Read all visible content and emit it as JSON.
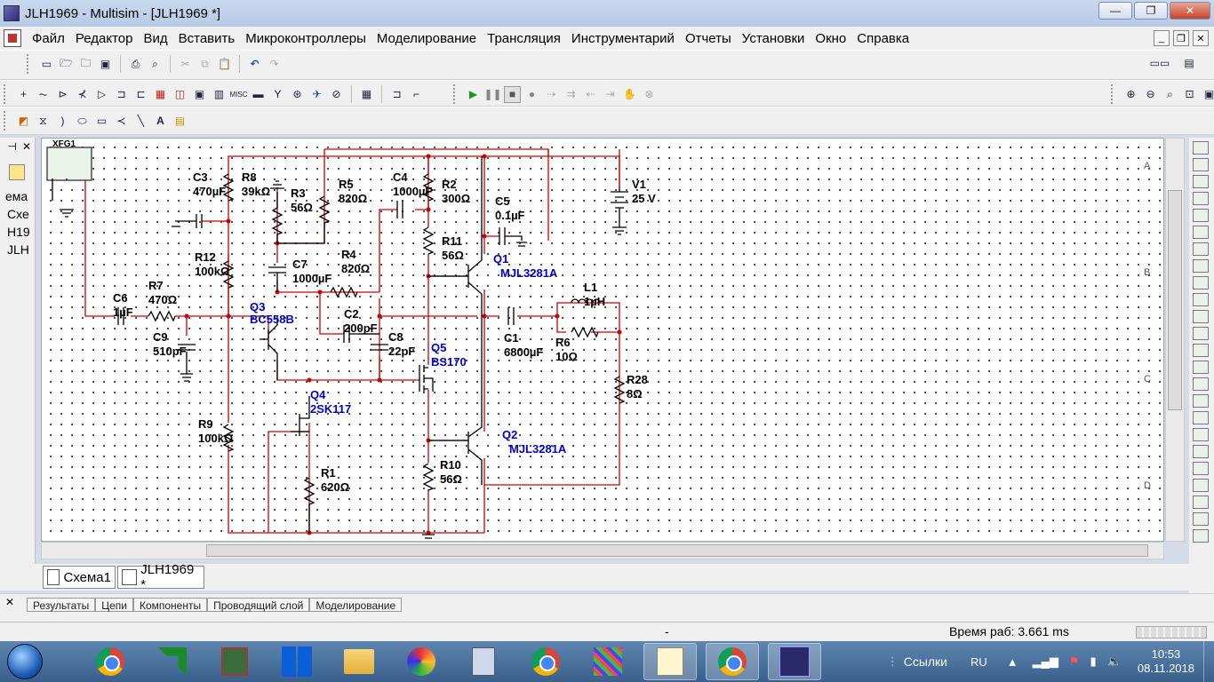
{
  "window": {
    "title": "JLH1969 - Multisim - [JLH1969 *]",
    "buttons": [
      "—",
      "❐",
      "✕"
    ]
  },
  "menu": [
    "Файл",
    "Редактор",
    "Вид",
    "Вставить",
    "Микроконтроллеры",
    "Моделирование",
    "Трансляция",
    "Инструментарий",
    "Отчеты",
    "Установки",
    "Окно",
    "Справка"
  ],
  "toolbar1": {
    "icons": [
      "new-icon",
      "open-icon",
      "open-folder-icon",
      "save-icon",
      "print-icon",
      "print-preview-icon",
      "cut-icon",
      "copy-icon",
      "paste-icon",
      "undo-icon",
      "redo-icon"
    ]
  },
  "toolbar2": {
    "component_icons": [
      "source-icon",
      "basic-icon",
      "diode-icon",
      "transistor-icon",
      "analog-icon",
      "ttl-icon",
      "cmos-icon",
      "mcu-icon",
      "advanced-peripherals-icon",
      "misc-digital-icon",
      "mixed-icon",
      "indicator-icon",
      "power-icon",
      "misc-icon",
      "rf-icon",
      "electromechanical-icon",
      "place-hierarchical-icon",
      "bus-icon"
    ],
    "sim_icons": [
      "run-icon",
      "pause-icon",
      "stop-icon",
      "record-icon"
    ]
  },
  "toolbar3": {
    "draw_icons": [
      "graphic-icon",
      "sigma-icon",
      "arc-icon",
      "ellipse-icon",
      "rectangle-icon",
      "multiline-icon",
      "line-icon",
      "text-icon",
      "comment-icon"
    ]
  },
  "leftpanel": {
    "lines": [
      "ема",
      "Схе",
      "H19",
      "JLH"
    ]
  },
  "canvas": {
    "border_labels": [
      "A",
      "B",
      "C",
      "D"
    ],
    "components": [
      {
        "ref": "C3",
        "value": "470µF"
      },
      {
        "ref": "R8",
        "value": "39kΩ"
      },
      {
        "ref": "R3",
        "value": "56Ω"
      },
      {
        "ref": "R5",
        "value": "820Ω"
      },
      {
        "ref": "C4",
        "value": "1000µF"
      },
      {
        "ref": "R2",
        "value": "300Ω"
      },
      {
        "ref": "C5",
        "value": "0.1µF"
      },
      {
        "ref": "V1",
        "value": "25 V"
      },
      {
        "ref": "R12",
        "value": "100kΩ"
      },
      {
        "ref": "C7",
        "value": "1000µF"
      },
      {
        "ref": "R4",
        "value": "820Ω"
      },
      {
        "ref": "R11",
        "value": "56Ω"
      },
      {
        "ref": "Q1",
        "value": "MJL3281A"
      },
      {
        "ref": "C6",
        "value": "1µF"
      },
      {
        "ref": "R7",
        "value": "470Ω"
      },
      {
        "ref": "Q3",
        "value": "BC558B"
      },
      {
        "ref": "C2",
        "value": "200pF"
      },
      {
        "ref": "C8",
        "value": "22pF"
      },
      {
        "ref": "C1",
        "value": "6800µF"
      },
      {
        "ref": "L1",
        "value": "1µH"
      },
      {
        "ref": "R6",
        "value": "10Ω"
      },
      {
        "ref": "C9",
        "value": "510pF"
      },
      {
        "ref": "Q5",
        "value": "BS170"
      },
      {
        "ref": "R28",
        "value": "8Ω"
      },
      {
        "ref": "Q4",
        "value": "2SK117"
      },
      {
        "ref": "R9",
        "value": "100kΩ"
      },
      {
        "ref": "Q2",
        "value": "MJL3281A"
      },
      {
        "ref": "R1",
        "value": "620Ω"
      },
      {
        "ref": "R10",
        "value": "56Ω"
      }
    ],
    "instrument_label": "XFG1"
  },
  "sheettabs": [
    "Схема1",
    "JLH1969 *"
  ],
  "spreadsheet_tabs": [
    "Результаты",
    "Цепи",
    "Компоненты",
    "Проводящий слой",
    "Моделирование"
  ],
  "status": {
    "left": "-",
    "sim_time": "Время раб: 3.661 ms"
  },
  "taskbar": {
    "apps": [
      "chrome",
      "amd",
      "app",
      "windows-apps",
      "explorer",
      "paint",
      "calculator",
      "chrome",
      "app",
      "notepad",
      "chrome",
      "multisim"
    ],
    "links_label": "Ссылки",
    "lang": "RU",
    "time": "10:53",
    "date": "08.11.2018"
  },
  "colors": {
    "wire": "#cc0000",
    "component": "#000000",
    "label_blue": "#0000cc"
  }
}
